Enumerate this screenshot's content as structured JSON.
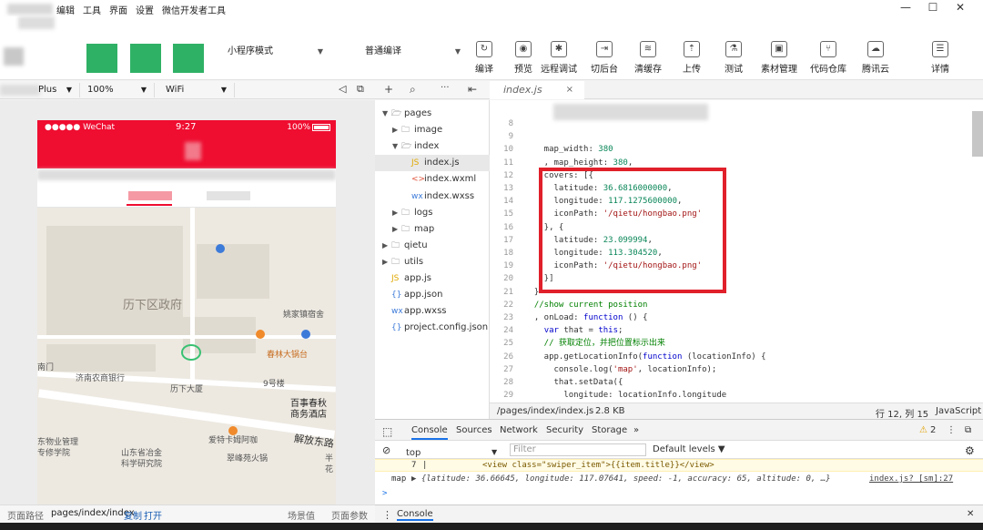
{
  "menubar": {
    "items": [
      "编辑",
      "工具",
      "界面",
      "设置",
      "微信开发者工具"
    ],
    "window_controls": [
      "—",
      "☐",
      "✕"
    ]
  },
  "toolbar": {
    "mode_select": "小程序模式",
    "compile_select": "普通编译",
    "buttons": [
      {
        "label": "编译",
        "icon": "refresh-icon"
      },
      {
        "label": "预览",
        "icon": "eye-icon"
      },
      {
        "label": "远程调试",
        "icon": "bug-icon"
      },
      {
        "label": "切后台",
        "icon": "switch-icon"
      },
      {
        "label": "清缓存",
        "icon": "layers-icon"
      },
      {
        "label": "上传",
        "icon": "upload-icon"
      },
      {
        "label": "测试",
        "icon": "flask-icon"
      },
      {
        "label": "素材管理",
        "icon": "assets-icon"
      },
      {
        "label": "代码仓库",
        "icon": "branch-icon"
      },
      {
        "label": "腾讯云",
        "icon": "cloud-icon"
      },
      {
        "label": "详情",
        "icon": "menu-icon"
      }
    ]
  },
  "simulator": {
    "device": "Plus",
    "zoom": "100%",
    "network": "WiFi",
    "status_bar": {
      "carrier": "●●●●● WeChat",
      "time": "9:27",
      "battery": "100%"
    },
    "map_labels": {
      "district_gov": "历下区政府",
      "yaojia": "姚家镇宿舍",
      "nanmen": "南门",
      "bank": "济南农商银行",
      "lixia_building": "历下大厦",
      "chunlin": "春林大锅台",
      "building9": "9号楼",
      "hotel_line1": "百事春秋",
      "hotel_line2": "商务酒店",
      "property_line1": "东物业管理",
      "property_line2": "专修学院",
      "metal_line1": "山东省冶金",
      "metal_line2": "科学研究院",
      "restaurant": "爱特卡姆阿咖",
      "hotpot": "翠峰苑火锅",
      "road": "解放东路",
      "edge_line1": "半",
      "edge_line2": "花"
    }
  },
  "simfoot": {
    "path_label": "页面路径",
    "path": "pages/index/index",
    "copy": "复制",
    "open": "打开",
    "scene": "场景值",
    "params": "页面参数"
  },
  "explorer": {
    "tools": [
      "+",
      "⌕",
      "···",
      "⇤"
    ],
    "items": [
      {
        "name": "pages",
        "type": "folder-open",
        "depth": 0
      },
      {
        "name": "image",
        "type": "folder",
        "depth": 1
      },
      {
        "name": "index",
        "type": "folder-open",
        "depth": 1
      },
      {
        "name": "index.js",
        "type": "js",
        "depth": 2
      },
      {
        "name": "index.wxml",
        "type": "wxml",
        "depth": 2
      },
      {
        "name": "index.wxss",
        "type": "wxss",
        "depth": 2
      },
      {
        "name": "logs",
        "type": "folder",
        "depth": 1
      },
      {
        "name": "map",
        "type": "folder",
        "depth": 1
      },
      {
        "name": "qietu",
        "type": "folder",
        "depth": 0
      },
      {
        "name": "utils",
        "type": "folder",
        "depth": 0
      },
      {
        "name": "app.js",
        "type": "js",
        "depth": 0
      },
      {
        "name": "app.json",
        "type": "json",
        "depth": 0
      },
      {
        "name": "app.wxss",
        "type": "wxss",
        "depth": 0
      },
      {
        "name": "project.config.json",
        "type": "json",
        "depth": 0
      }
    ]
  },
  "editor": {
    "tab": "index.js",
    "close": "×",
    "lines": [
      {
        "n": "8",
        "t": ""
      },
      {
        "n": "9",
        "t": ""
      },
      {
        "n": "10",
        "t": "    map_width: 380"
      },
      {
        "n": "11",
        "t": "    , map_height: 380,"
      },
      {
        "n": "12",
        "t": "    covers: [{"
      },
      {
        "n": "13",
        "t": "      latitude: 36.6816000000,"
      },
      {
        "n": "14",
        "t": "      longitude: 117.1275600000,"
      },
      {
        "n": "15",
        "t": "      iconPath: '/qietu/hongbao.png'"
      },
      {
        "n": "16",
        "t": "    }, {"
      },
      {
        "n": "17",
        "t": "      latitude: 23.099994,"
      },
      {
        "n": "18",
        "t": "      longitude: 113.304520,"
      },
      {
        "n": "19",
        "t": "      iconPath: '/qietu/hongbao.png'"
      },
      {
        "n": "20",
        "t": "    }]"
      },
      {
        "n": "21",
        "t": "  }"
      },
      {
        "n": "22",
        "t": "  //show current position"
      },
      {
        "n": "23",
        "t": "  , onLoad: function () {"
      },
      {
        "n": "24",
        "t": "    var that = this;"
      },
      {
        "n": "25",
        "t": "    // 获取定位，并把位置标示出来"
      },
      {
        "n": "26",
        "t": "    app.getLocationInfo(function (locationInfo) {"
      },
      {
        "n": "27",
        "t": "      console.log('map', locationInfo);"
      },
      {
        "n": "28",
        "t": "      that.setData({"
      },
      {
        "n": "29",
        "t": "        longitude: locationInfo.longitude"
      }
    ],
    "status": {
      "path": "/pages/index/index.js",
      "size": "2.8 KB",
      "cursor": "行 12, 列 15",
      "lang": "JavaScript"
    }
  },
  "devtools": {
    "tabs": [
      "Console",
      "Sources",
      "Network",
      "Security",
      "Storage",
      "»"
    ],
    "warn_count": "2",
    "context": "top",
    "filter_placeholder": "Filter",
    "levels": "Default levels ▼",
    "console_lines": {
      "warn_num": "7",
      "warn_code": "<view class=\"swiper_item\">{{item.title}}</view>",
      "log_label": "map",
      "log_obj": "▶ {latitude: 36.66645, longitude: 117.07641, speed: -1, accuracy: 65, altitude: 0, …}",
      "log_src": "index.js? [sm]:27",
      "prompt": ">"
    },
    "drawer_tab": "Console"
  }
}
